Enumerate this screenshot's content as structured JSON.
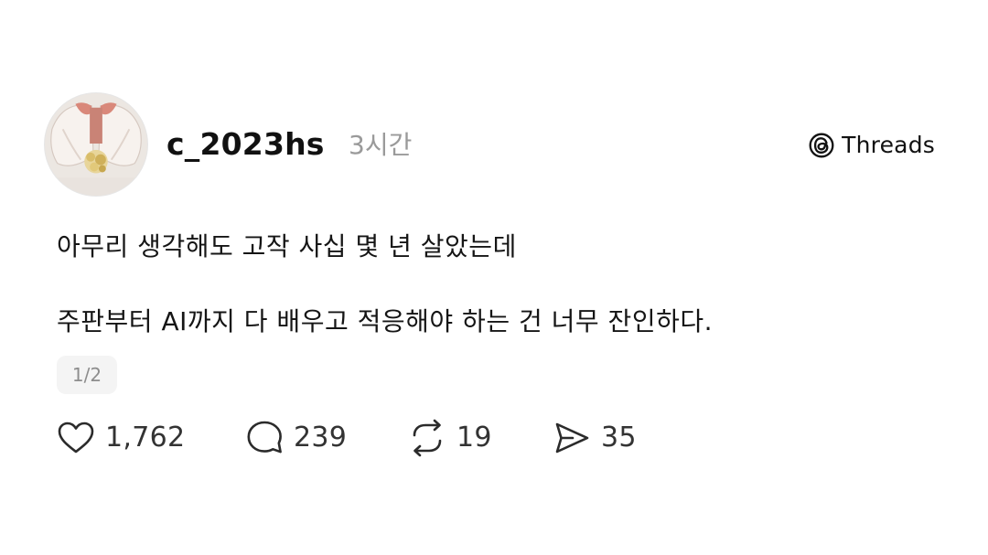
{
  "post": {
    "username": "c_2023hs",
    "timestamp": "3시간",
    "brand": {
      "label": "Threads",
      "icon": "threads-logo-icon"
    },
    "body_lines": [
      "아무리 생각해도 고작 사십 몇 년 살았는데",
      "주판부터 AI까지 다 배우고 적응해야 하는 건 너무 잔인하다."
    ],
    "page_indicator": "1/2",
    "actions": {
      "likes": {
        "icon": "heart-icon",
        "count": "1,762"
      },
      "replies": {
        "icon": "comment-bubble-icon",
        "count": "239"
      },
      "reposts": {
        "icon": "repost-icon",
        "count": "19"
      },
      "shares": {
        "icon": "send-icon",
        "count": "35"
      }
    },
    "colors": {
      "text": "#111111",
      "muted": "#9a9a9a",
      "badge_bg": "#f4f4f4"
    }
  }
}
